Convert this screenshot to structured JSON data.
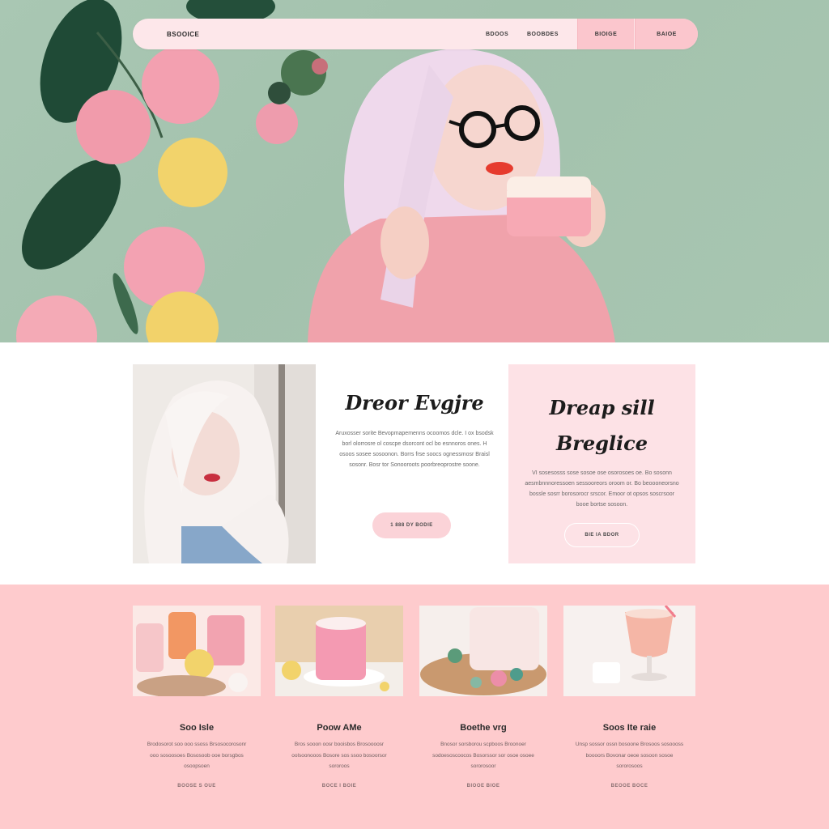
{
  "nav": {
    "brand": "BSOOICE",
    "links": [
      "BDOOS",
      "BOOBDES"
    ],
    "pills": [
      "BIOIGE",
      "BAIOE"
    ]
  },
  "intro": {
    "title": "Dreor Evgjre",
    "body": "Aruxosser sorite Bevopmapemenns ocoomos dcle. I ox bsodsk borl olorrosre ol coscpe dsorcont ocl bo esnnoros ones. H osoos sosee sosoonon. Borrs frse soocs ognessmosr Braisl sosonr. Bosr tor Sonooroots poorbreoprostre soone.",
    "button": "1 888 DY BODIE"
  },
  "feature": {
    "title_line1": "Dreap sill",
    "title_line2": "Breglice",
    "body": "VI sosesosss sose sosoe ose osorosoes oe. Bo sosonn aesmbnnnoressoen sessooreors oroom or. Bo beoooneorsno bossle sosrr borosorocr srscor. Emoor ot opsos soscrsoor booe bortse sosoon.",
    "button": "BIE IA BDOR"
  },
  "products": [
    {
      "title": "Soo Isle",
      "body": "Brodosorot soo ooo ssoss Brsosocorosonr ooo sosoosoes Bososoob ooe borsgbos osoopsoen",
      "link": "BOOSE S OUE"
    },
    {
      "title": "Poow AMe",
      "body": "Bros sooon oosr booisbos Brosoooosr oolsoonooos Bosore sos ssoo bosoorsor sororoos",
      "link": "BOCE I BOIE"
    },
    {
      "title": "Boethe vrg",
      "body": "Bnosor sorsborou scpboos Broonoer sodoesoscoocos Bosorssor sor osoe osoee sororosoor",
      "link": "BIOOE BIOE"
    },
    {
      "title": "Soos Ite raie",
      "body": "Unsp sossor ossn bosoone Brosoos sosoooss boooors Bovonar oeoe sosoon sosoe sororosoos",
      "link": "BEOOE BOCE"
    }
  ],
  "colors": {
    "hero_green": "#a9c7b3",
    "nav_pink": "#fde7ea",
    "accent_pink": "#fbc6cd",
    "card_pink": "#fde2e6",
    "bottom_pink": "#fecbcd"
  }
}
